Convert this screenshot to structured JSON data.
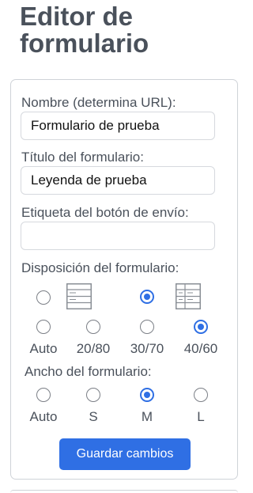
{
  "page_title": "Editor de formulario",
  "fields": {
    "name": {
      "label": "Nombre (determina URL):",
      "value": "Formulario de prueba"
    },
    "form_title": {
      "label": "Título del formulario:",
      "value": "Leyenda de prueba"
    },
    "submit_label": {
      "label": "Etiqueta del botón de envío:",
      "value": ""
    }
  },
  "layout": {
    "label": "Disposición del formulario:",
    "style_icons": [
      "single-column-form-icon",
      "two-column-form-icon"
    ],
    "style_selected": 1,
    "ratios": [
      "Auto",
      "20/80",
      "30/70",
      "40/60"
    ],
    "ratio_selected": 3
  },
  "width": {
    "label": "Ancho del formulario:",
    "options": [
      "Auto",
      "S",
      "M",
      "L"
    ],
    "selected": 2
  },
  "save_label": "Guardar cambios",
  "colors": {
    "accent": "#2f6fe4",
    "text": "#4a515b",
    "border": "#cfd3d8"
  }
}
